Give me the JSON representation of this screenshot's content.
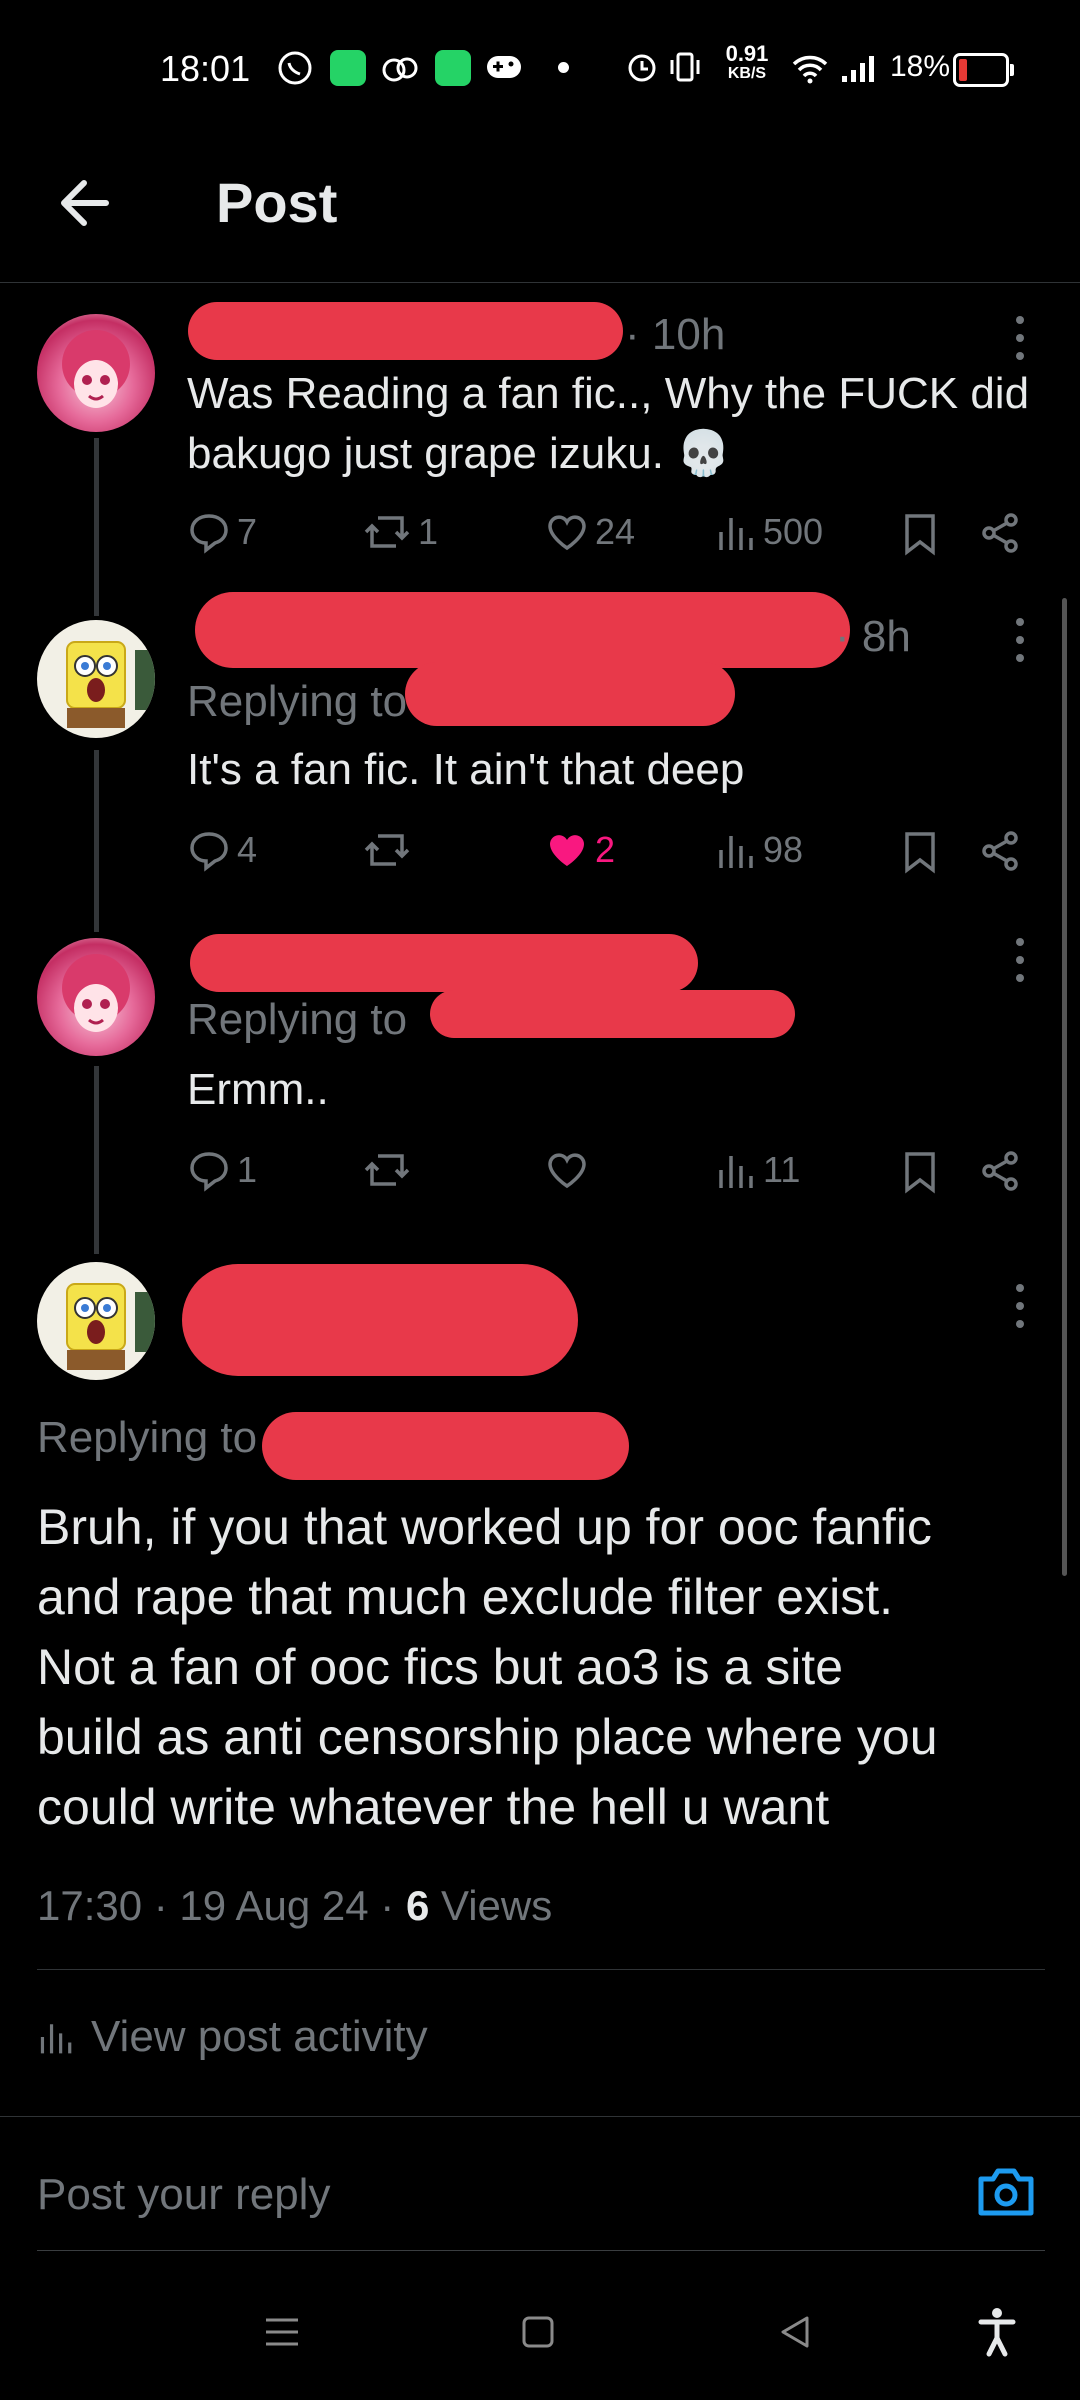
{
  "status_bar": {
    "time": "18:01",
    "net_speed_value": "0.91",
    "net_speed_unit": "KB/S",
    "battery": "18%",
    "battery_level": 0.18,
    "battery_color": "#e53935"
  },
  "header": {
    "title": "Post"
  },
  "posts": [
    {
      "time": "· 10h",
      "text_line1": "Was Reading a fan fic.., Why the FUCK did",
      "text_line2": "bakugo just grape izuku.",
      "replies": "7",
      "reposts": "1",
      "likes": "24",
      "views": "500"
    },
    {
      "time": "· 8h",
      "replying_to": "Replying to",
      "text": "It's a fan fic. It ain't that deep",
      "replies": "4",
      "reposts": "",
      "likes": "2",
      "liked": true,
      "like_color": "#f91880",
      "views": "98"
    },
    {
      "replying_to": "Replying to",
      "text": "Ermm..",
      "replies": "1",
      "reposts": "",
      "likes": "",
      "views": "11"
    }
  ],
  "main_post": {
    "replying_to": "Replying to",
    "text_lines": [
      "Bruh, if you that worked up for ooc fanfic",
      "and rape that much exclude filter exist.",
      "Not a fan of ooc fics but ao3 is a site",
      "build as anti censorship place where you",
      "could write whatever the hell u want"
    ],
    "timestamp": "17:30 · 19 Aug 24 · ",
    "views_count": "6",
    "views_label": " Views"
  },
  "activity": {
    "label": "View post activity"
  },
  "composer": {
    "placeholder": "Post your reply",
    "accent": "#1d9bf0"
  }
}
